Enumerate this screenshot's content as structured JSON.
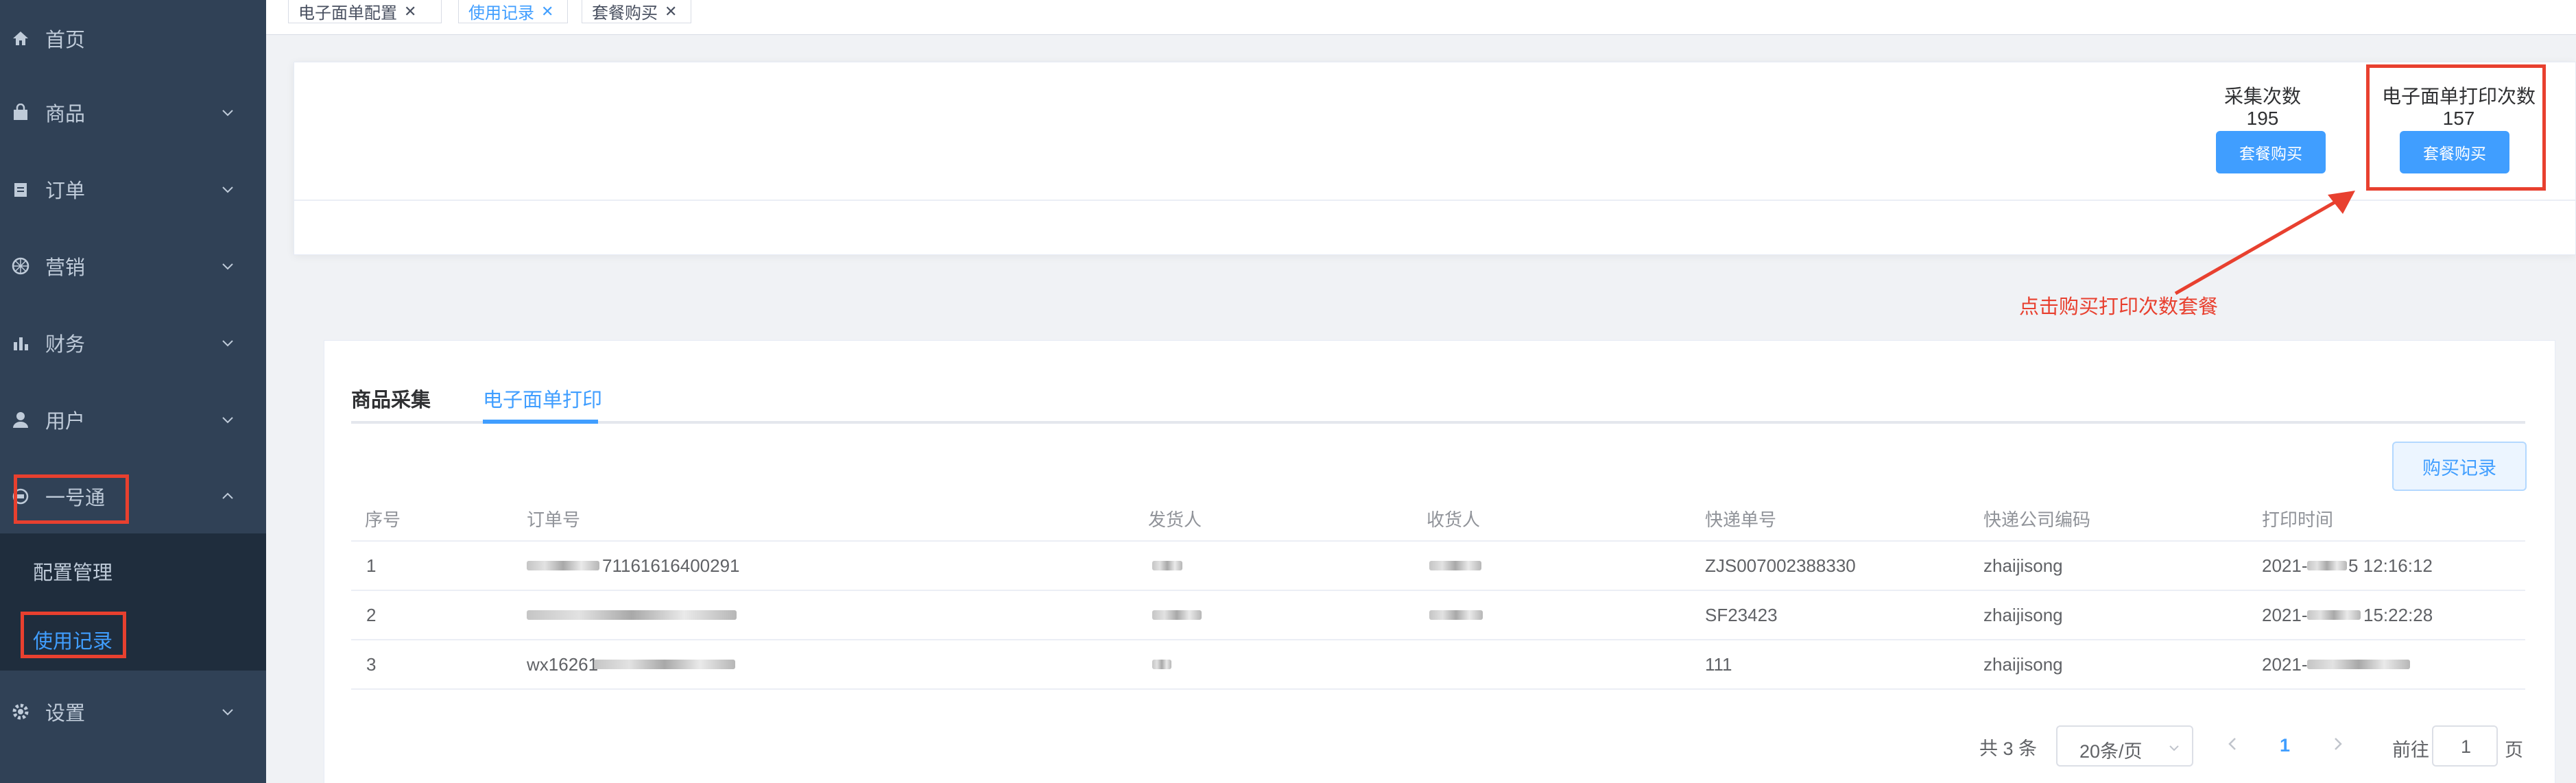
{
  "sidebar": {
    "items": [
      {
        "label": "首页",
        "icon": "home-icon"
      },
      {
        "label": "商品",
        "icon": "bag-icon"
      },
      {
        "label": "订单",
        "icon": "clipboard-icon"
      },
      {
        "label": "营销",
        "icon": "marketing-icon"
      },
      {
        "label": "财务",
        "icon": "chart-icon"
      },
      {
        "label": "用户",
        "icon": "user-icon"
      },
      {
        "label": "一号通",
        "icon": "circle-icon"
      },
      {
        "label": "设置",
        "icon": "gear-icon"
      }
    ],
    "submenu": [
      "配置管理",
      "使用记录"
    ]
  },
  "tags": [
    "电子面单配置",
    "使用记录",
    "套餐购买"
  ],
  "counters": [
    {
      "label": "采集次数",
      "value": "195",
      "button": "套餐购买"
    },
    {
      "label": "电子面单打印次数",
      "value": "157",
      "button": "套餐购买"
    }
  ],
  "annotation": "点击购买打印次数套餐",
  "tabs": [
    "商品采集",
    "电子面单打印"
  ],
  "purchase_btn": "购买记录",
  "table": {
    "headers": [
      "序号",
      "订单号",
      "发货人",
      "收货人",
      "快递单号",
      "快递公司编码",
      "打印时间"
    ],
    "rows": [
      {
        "no": "1",
        "order_tail": "71161616400291",
        "tracking": "ZJS007002388330",
        "company": "zhaijisong",
        "time_head": "2021-",
        "time_tail": "5 12:16:12"
      },
      {
        "no": "2",
        "order_tail": "",
        "tracking": "SF23423",
        "company": "zhaijisong",
        "time_head": "2021-",
        "time_tail": "15:22:28"
      },
      {
        "no": "3",
        "order_tail": "",
        "order_head": "wx16261",
        "tracking": "111",
        "company": "zhaijisong",
        "time_head": "2021-",
        "time_tail": ""
      }
    ]
  },
  "pagination": {
    "total": "共 3 条",
    "page_size": "20条/页",
    "current": "1",
    "goto": "前往",
    "goto_value": "1",
    "page_unit": "页"
  }
}
